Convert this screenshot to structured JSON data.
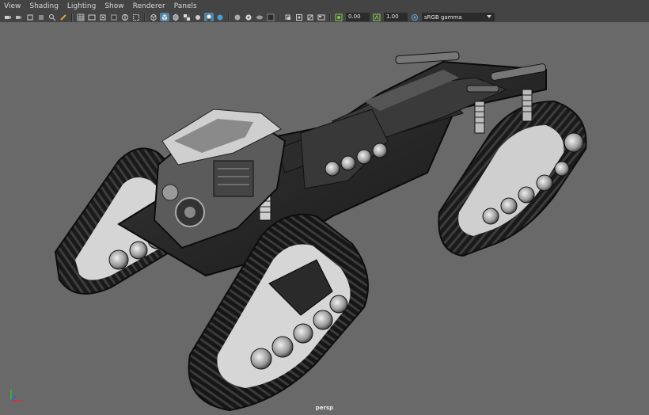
{
  "menu": {
    "items": [
      "View",
      "Shading",
      "Lighting",
      "Show",
      "Renderer",
      "Panels"
    ]
  },
  "toolbar": {
    "exposure_value": "0.00",
    "gamma_value": "1.00",
    "color_space": "sRGB gamma"
  },
  "viewport": {
    "camera_label": "persp",
    "background_color": "#696969"
  },
  "colors": {
    "active_button": "#5285a6",
    "model_dark": "#1e1e1e",
    "model_light": "#d8d8d8"
  }
}
